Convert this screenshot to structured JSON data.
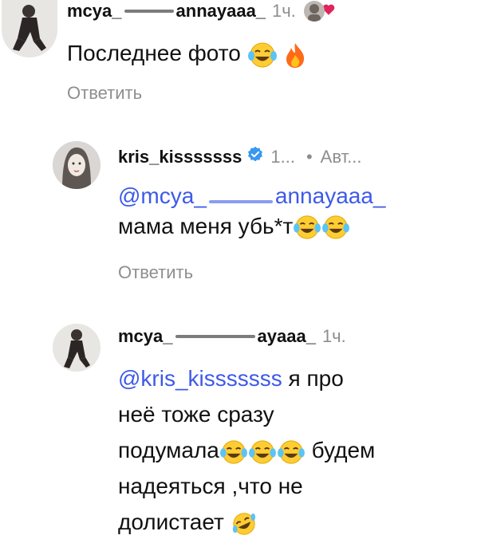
{
  "comments": [
    {
      "username_prefix": "mcya_",
      "username_suffix": "annayaaa_",
      "time": "1ч.",
      "text": "Последнее фото",
      "reply_label": "Ответить"
    },
    {
      "username": "kris_kisssssss",
      "time": "1...",
      "dot": "•",
      "author_label": "Авт...",
      "mention_prefix": "@mcya_",
      "mention_suffix": "annayaaa_",
      "text": "мама меня убь*т",
      "reply_label": "Ответить"
    },
    {
      "username_prefix": "mcya_",
      "username_suffix": "ayaaa_",
      "time": "1ч.",
      "mention": "@kris_kisssssss",
      "line1_rest": " я про",
      "line2": "неё тоже сразу",
      "line3_a": "подумала",
      "line3_b": " будем",
      "line4": "надеяться ,что не",
      "line5": "долистает "
    }
  ],
  "colors": {
    "mention": "#3d5ae8",
    "meta": "#8e8e8e",
    "heart": "#e0245e",
    "verified": "#3897f0"
  },
  "icons": [
    "avatar",
    "joy-emoji",
    "fire-emoji",
    "rofl-emoji",
    "heart-icon",
    "verified-badge-icon"
  ]
}
